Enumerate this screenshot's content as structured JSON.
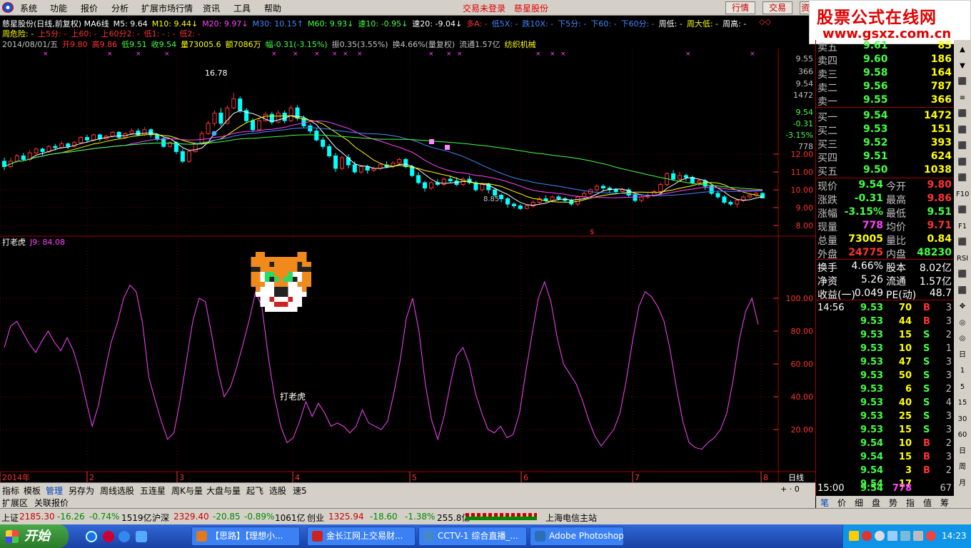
{
  "menu": [
    "系统",
    "功能",
    "报价",
    "分析",
    "扩展市场行情",
    "资讯",
    "工具",
    "帮助"
  ],
  "status_login": "交易未登录",
  "stock_title": "慈星股份",
  "top_buttons": [
    "行情",
    "交易",
    "资"
  ],
  "logo": {
    "line1": "股票公式在线网",
    "line2": "www.gsxz.com.cn"
  },
  "ma_line": [
    {
      "t": "慈星股份(日线,前复权) MA6线",
      "c": "#ffffff"
    },
    {
      "t": "M5: 9.64",
      "c": "#ffffff"
    },
    {
      "t": "M10: 9.44↓",
      "c": "#ffff00"
    },
    {
      "t": "M20: 9.97↓",
      "c": "#ff44ff"
    },
    {
      "t": "M30: 10.15↑",
      "c": "#4488ff"
    },
    {
      "t": "M60: 9.93↓",
      "c": "#44ff44"
    },
    {
      "t": "速10: -0.95↓",
      "c": "#44ff44"
    },
    {
      "t": "速20: -9.04↓",
      "c": "#ffffff"
    },
    {
      "t": "多A: -",
      "c": "#ff3333"
    },
    {
      "t": "低5X: -",
      "c": "#4488ff"
    },
    {
      "t": "跌10X: -",
      "c": "#4488ff"
    },
    {
      "t": "下5分: -",
      "c": "#4488ff"
    },
    {
      "t": "下60: -",
      "c": "#4488ff"
    },
    {
      "t": "下60分: -",
      "c": "#4488ff"
    },
    {
      "t": "周低: -",
      "c": "#ffffff"
    },
    {
      "t": "周大低: -",
      "c": "#ffff00"
    },
    {
      "t": "周高: -",
      "c": "#ffffff"
    }
  ],
  "risk_line": [
    {
      "t": "周危险: -",
      "c": "#ffff00"
    },
    {
      "t": "上5分: -",
      "c": "#ff3333"
    },
    {
      "t": "上60: -",
      "c": "#ff3333"
    },
    {
      "t": "上60分2: -",
      "c": "#ff3333"
    },
    {
      "t": "低1: -  : -",
      "c": "#ff3333"
    },
    {
      "t": "低2: -",
      "c": "#ff3333"
    }
  ],
  "day_line": [
    {
      "t": "2014/08/01/五",
      "c": "#c0c0c0"
    },
    {
      "t": "开9.80",
      "c": "#ff3333"
    },
    {
      "t": "高9.86",
      "c": "#ff3333"
    },
    {
      "t": "低9.51",
      "c": "#44ff44"
    },
    {
      "t": "收9.54",
      "c": "#44ff44"
    },
    {
      "t": "量73005.6",
      "c": "#ffff00"
    },
    {
      "t": "额7086万",
      "c": "#ffff00"
    },
    {
      "t": "幅-0.31(-3.15%)",
      "c": "#44ff44"
    },
    {
      "t": "振0.35(3.55%)",
      "c": "#c0c0c0"
    },
    {
      "t": "换4.66%(量复权)",
      "c": "#c0c0c0"
    },
    {
      "t": "流通1.57亿",
      "c": "#c0c0c0"
    },
    {
      "t": "纺织机械",
      "c": "#ffff00"
    }
  ],
  "hi_label": "16.78",
  "lo_label": "8.85",
  "price_axis": [
    "12.00",
    "11.00",
    "10.00",
    "9.00",
    "8.00"
  ],
  "price_axis_top": [
    {
      "t": "9.55",
      "c": "#c0c0c0"
    },
    {
      "t": "366",
      "c": "#c0c0c0"
    },
    {
      "t": "9.54",
      "c": "#c0c0c0"
    },
    {
      "t": "1472",
      "c": "#c0c0c0"
    },
    {
      "t": "9.54",
      "c": "#44ff44"
    },
    {
      "t": "-0.31",
      "c": "#44ff44"
    },
    {
      "t": "-3.15%",
      "c": "#44ff44"
    },
    {
      "t": "778",
      "c": "#c0c0c0"
    }
  ],
  "indicator": {
    "name": "打老虎",
    "j_label": "J9: 84.08",
    "center_label": "打老虎"
  },
  "ind_axis": [
    "100.00",
    "80.00",
    "60.00",
    "40.00",
    "20.00"
  ],
  "date_axis": [
    "2014年",
    "2",
    "3",
    "4",
    "5",
    "6",
    "7",
    "8"
  ],
  "date_right": "日线",
  "chart_data": {
    "type": "candlestick",
    "price_ylim": [
      8,
      12
    ],
    "indicator_ylim": [
      0,
      100
    ],
    "candles": [
      [
        11.6,
        11.3,
        11.8,
        11.1
      ],
      [
        11.3,
        11.6,
        11.8,
        11.2
      ],
      [
        11.6,
        11.9,
        12.0,
        11.5
      ],
      [
        11.9,
        11.7,
        12.1,
        11.6
      ],
      [
        11.7,
        12.1,
        12.3,
        11.6
      ],
      [
        12.1,
        12.4,
        12.5,
        12.0
      ],
      [
        12.4,
        12.2,
        12.5,
        11.9
      ],
      [
        12.2,
        12.6,
        12.7,
        12.1
      ],
      [
        12.6,
        12.5,
        12.8,
        12.3
      ],
      [
        12.5,
        12.8,
        13.0,
        12.4
      ],
      [
        12.8,
        12.6,
        12.9,
        12.4
      ],
      [
        12.6,
        12.9,
        13.0,
        12.5
      ],
      [
        12.9,
        13.3,
        13.4,
        12.8
      ],
      [
        13.3,
        13.1,
        13.5,
        12.9
      ],
      [
        13.1,
        13.5,
        13.6,
        13.0
      ],
      [
        13.5,
        13.2,
        13.6,
        13.0
      ],
      [
        13.2,
        13.4,
        13.5,
        13.1
      ],
      [
        13.4,
        13.7,
        13.8,
        13.3
      ],
      [
        13.7,
        13.3,
        13.8,
        13.2
      ],
      [
        13.3,
        13.6,
        13.7,
        13.2
      ],
      [
        13.6,
        13.8,
        14.0,
        13.5
      ],
      [
        13.8,
        13.5,
        14.0,
        13.4
      ],
      [
        13.5,
        13.9,
        14.1,
        13.4
      ],
      [
        13.9,
        13.5,
        14.0,
        13.3
      ],
      [
        13.5,
        13.2,
        13.6,
        13.0
      ],
      [
        13.2,
        12.6,
        13.3,
        12.5
      ],
      [
        12.6,
        12.9,
        13.0,
        12.5
      ],
      [
        12.9,
        12.2,
        13.0,
        12.0
      ],
      [
        12.2,
        11.6,
        12.4,
        11.5
      ],
      [
        11.6,
        12.2,
        12.3,
        11.5
      ],
      [
        12.2,
        12.8,
        12.9,
        12.1
      ],
      [
        12.8,
        13.6,
        13.8,
        12.7
      ],
      [
        13.6,
        14.4,
        14.6,
        13.5
      ],
      [
        14.4,
        15.2,
        15.4,
        14.2
      ],
      [
        15.2,
        14.4,
        15.6,
        14.2
      ],
      [
        14.4,
        15.6,
        15.8,
        14.3
      ],
      [
        15.6,
        16.3,
        16.78,
        15.5
      ],
      [
        16.3,
        15.4,
        16.5,
        15.2
      ],
      [
        15.4,
        14.6,
        15.6,
        14.4
      ],
      [
        14.6,
        13.9,
        14.8,
        13.7
      ],
      [
        13.9,
        14.6,
        14.8,
        13.8
      ],
      [
        14.6,
        15.1,
        15.3,
        14.5
      ],
      [
        15.1,
        14.5,
        15.3,
        14.3
      ],
      [
        14.5,
        15.2,
        15.4,
        14.4
      ],
      [
        15.2,
        14.6,
        15.4,
        14.4
      ],
      [
        14.6,
        15.6,
        15.8,
        14.5
      ],
      [
        15.6,
        14.8,
        15.8,
        14.6
      ],
      [
        14.8,
        14.2,
        15.0,
        14.0
      ],
      [
        14.2,
        13.8,
        14.4,
        13.6
      ],
      [
        13.8,
        13.1,
        14.0,
        13.0
      ],
      [
        13.1,
        12.6,
        13.3,
        12.4
      ],
      [
        12.6,
        11.9,
        12.8,
        11.8
      ],
      [
        11.9,
        11.2,
        12.1,
        11.0
      ],
      [
        11.2,
        11.8,
        11.9,
        11.1
      ],
      [
        11.8,
        11.4,
        12.0,
        11.2
      ],
      [
        11.4,
        11.0,
        11.6,
        10.9
      ],
      [
        11.0,
        11.3,
        11.4,
        10.9
      ],
      [
        11.3,
        11.1,
        11.4,
        10.9
      ],
      [
        11.1,
        11.2,
        11.3,
        11.0
      ],
      [
        11.2,
        11.4,
        11.5,
        11.1
      ],
      [
        11.4,
        11.3,
        11.6,
        11.2
      ],
      [
        11.3,
        11.5,
        11.6,
        11.2
      ],
      [
        11.5,
        11.7,
        11.8,
        11.4
      ],
      [
        11.7,
        11.3,
        11.8,
        11.2
      ],
      [
        11.3,
        10.8,
        11.4,
        10.7
      ],
      [
        10.8,
        10.4,
        11.0,
        10.3
      ],
      [
        10.4,
        10.1,
        10.5,
        9.9
      ],
      [
        10.1,
        10.4,
        10.5,
        10.0
      ],
      [
        10.4,
        10.3,
        10.6,
        10.2
      ],
      [
        10.3,
        10.6,
        10.7,
        10.2
      ],
      [
        10.6,
        10.5,
        10.8,
        10.4
      ],
      [
        10.5,
        10.3,
        10.7,
        10.2
      ],
      [
        10.3,
        10.6,
        10.7,
        10.2
      ],
      [
        10.6,
        10.4,
        10.8,
        10.3
      ],
      [
        10.4,
        10.0,
        10.5,
        9.9
      ],
      [
        10.0,
        10.3,
        10.4,
        9.9
      ],
      [
        10.3,
        10.0,
        10.4,
        9.8
      ],
      [
        10.0,
        9.7,
        10.1,
        9.6
      ],
      [
        9.7,
        9.5,
        9.8,
        9.3
      ],
      [
        9.5,
        9.2,
        9.6,
        9.0
      ],
      [
        9.2,
        9.1,
        9.3,
        8.95
      ],
      [
        9.1,
        8.95,
        9.2,
        8.85
      ],
      [
        8.95,
        9.1,
        9.2,
        8.9
      ],
      [
        9.1,
        9.3,
        9.4,
        9.0
      ],
      [
        9.3,
        9.5,
        9.6,
        9.2
      ],
      [
        9.5,
        9.4,
        9.7,
        9.3
      ],
      [
        9.4,
        9.6,
        9.7,
        9.3
      ],
      [
        9.6,
        9.5,
        9.7,
        9.4
      ],
      [
        9.5,
        9.4,
        9.6,
        9.3
      ],
      [
        9.4,
        9.2,
        9.5,
        9.1
      ],
      [
        9.2,
        9.6,
        9.7,
        9.1
      ],
      [
        9.6,
        9.8,
        9.9,
        9.5
      ],
      [
        9.8,
        10.0,
        10.1,
        9.7
      ],
      [
        10.0,
        10.2,
        10.3,
        9.9
      ],
      [
        10.2,
        10.1,
        10.3,
        9.9
      ],
      [
        10.1,
        10.0,
        10.2,
        9.8
      ],
      [
        10.0,
        9.9,
        10.1,
        9.8
      ],
      [
        9.9,
        10.0,
        10.1,
        9.8
      ],
      [
        10.0,
        9.7,
        10.1,
        9.6
      ],
      [
        9.7,
        9.4,
        9.8,
        9.3
      ],
      [
        9.4,
        9.6,
        9.7,
        9.3
      ],
      [
        9.6,
        9.7,
        9.8,
        9.5
      ],
      [
        9.7,
        9.9,
        10.0,
        9.6
      ],
      [
        9.9,
        10.3,
        10.4,
        9.8
      ],
      [
        10.3,
        10.9,
        11.0,
        10.2
      ],
      [
        10.9,
        10.6,
        11.1,
        10.5
      ],
      [
        10.6,
        10.8,
        11.0,
        10.5
      ],
      [
        10.8,
        10.7,
        10.9,
        10.5
      ],
      [
        10.7,
        10.4,
        10.8,
        10.3
      ],
      [
        10.4,
        10.5,
        10.6,
        10.2
      ],
      [
        10.5,
        10.2,
        10.6,
        10.0
      ],
      [
        10.2,
        9.8,
        10.3,
        9.7
      ],
      [
        9.8,
        9.6,
        9.9,
        9.5
      ],
      [
        9.6,
        9.3,
        9.7,
        9.2
      ],
      [
        9.3,
        9.2,
        9.4,
        9.1
      ],
      [
        9.2,
        9.4,
        9.5,
        9.0
      ],
      [
        9.4,
        9.6,
        9.7,
        9.3
      ],
      [
        9.6,
        9.7,
        9.8,
        9.5
      ],
      [
        9.7,
        9.8,
        9.9,
        9.6
      ],
      [
        9.8,
        9.54,
        9.86,
        9.51
      ]
    ],
    "indicator_j": [
      70,
      83,
      86,
      79,
      72,
      67,
      74,
      80,
      73,
      68,
      76,
      68,
      55,
      38,
      22,
      35,
      55,
      73,
      85,
      100,
      108,
      104,
      85,
      52,
      38,
      25,
      14,
      18,
      38,
      62,
      86,
      100,
      98,
      78,
      56,
      40,
      46,
      58,
      72,
      87,
      104,
      95,
      65,
      40,
      22,
      12,
      15,
      25,
      37,
      28,
      36,
      30,
      22,
      24,
      22,
      18,
      22,
      32,
      24,
      22,
      20,
      25,
      42,
      62,
      88,
      100,
      80,
      48,
      26,
      14,
      28,
      48,
      65,
      70,
      60,
      42,
      30,
      20,
      18,
      22,
      15,
      17,
      30,
      55,
      78,
      100,
      110,
      98,
      76,
      60,
      54,
      48,
      38,
      26,
      16,
      10,
      15,
      20,
      30,
      50,
      74,
      95,
      104,
      101,
      95,
      86,
      68,
      45,
      25,
      12,
      9,
      8,
      12,
      15,
      20,
      30,
      50,
      75,
      92,
      100,
      84
    ]
  }
}
